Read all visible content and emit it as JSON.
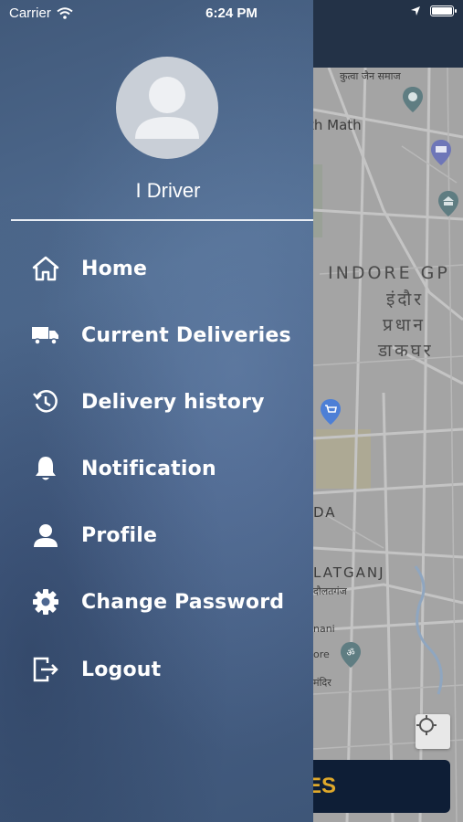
{
  "status_bar": {
    "carrier": "Carrier",
    "time": "6:24 PM"
  },
  "drawer": {
    "user_name": "I Driver",
    "menu": [
      {
        "label": "Home",
        "icon": "home-icon"
      },
      {
        "label": "Current Deliveries",
        "icon": "truck-icon"
      },
      {
        "label": "Delivery history",
        "icon": "history-icon"
      },
      {
        "label": "Notification",
        "icon": "bell-icon"
      },
      {
        "label": "Profile",
        "icon": "user-icon"
      },
      {
        "label": "Change Password",
        "icon": "gear-icon"
      },
      {
        "label": "Logout",
        "icon": "logout-icon"
      }
    ]
  },
  "map": {
    "labels": {
      "top": "कुत्वा जैन समाज",
      "math": "th Math",
      "indore": "INDORE GP",
      "hindi1": "इंदौर",
      "hindi2": "प्रधान",
      "hindi3": "डाकघर",
      "da": "DA",
      "latganj": "LATGANJ",
      "latganj_hi": "दौलतगंज",
      "nani": "nani",
      "ore": "ore",
      "mandir": "मंदिर"
    },
    "bottom_button_fragment": "ES"
  },
  "colors": {
    "drawer": "#4a6389",
    "bottom_button": "#0e1e36",
    "bottom_button_text": "#e0a92a"
  }
}
